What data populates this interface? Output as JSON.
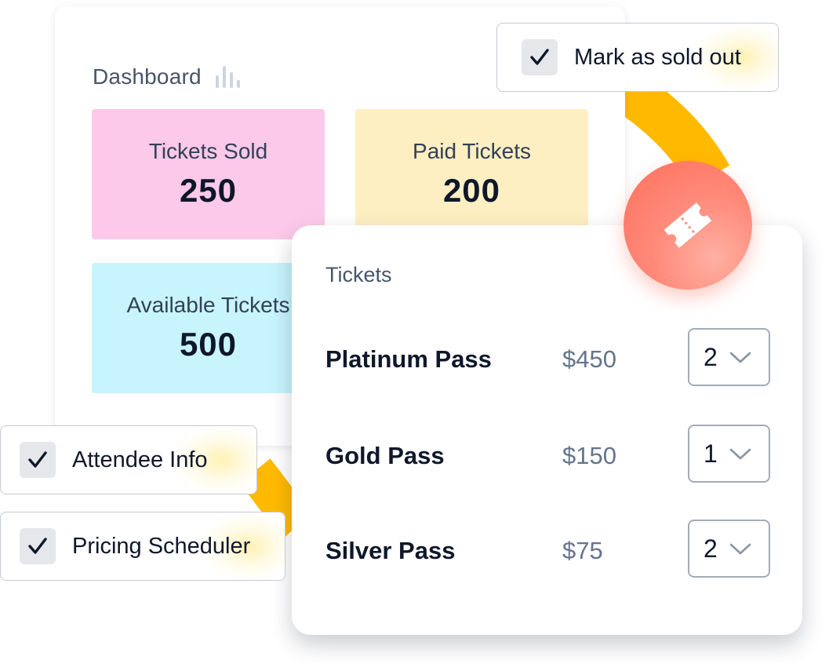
{
  "dashboard": {
    "title": "Dashboard",
    "icon": "bar-chart-icon",
    "stats": {
      "tickets_sold": {
        "label": "Tickets Sold",
        "value": "250",
        "color": "#fcc9ea"
      },
      "paid_tickets": {
        "label": "Paid Tickets",
        "value": "200",
        "color": "#feefc3"
      },
      "available_tickets": {
        "label": "Available Tickets",
        "value": "500",
        "color": "#c8f4fd"
      }
    }
  },
  "tickets": {
    "title": "Tickets",
    "badge_icon": "ticket-icon",
    "badge_color": "#ff7a68",
    "rows": [
      {
        "name": "Platinum Pass",
        "price": "$450",
        "quantity": "2"
      },
      {
        "name": "Gold Pass",
        "price": "$150",
        "quantity": "1"
      },
      {
        "name": "Silver Pass",
        "price": "$75",
        "quantity": "2"
      }
    ]
  },
  "options": {
    "mark_sold_out": {
      "label": "Mark as sold out",
      "checked": true
    },
    "attendee_info": {
      "label": "Attendee Info",
      "checked": true
    },
    "pricing_scheduler": {
      "label": "Pricing Scheduler",
      "checked": true
    }
  },
  "colors": {
    "accent_ribbon": "#ffb800",
    "checkbox_bg": "#e5e7eb"
  }
}
